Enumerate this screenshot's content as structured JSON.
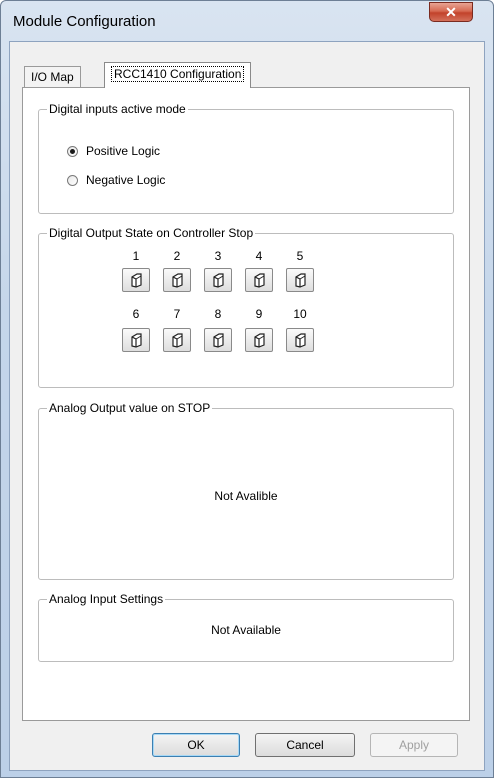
{
  "window": {
    "title": "Module Configuration",
    "close_glyph": "✕"
  },
  "tabs": [
    {
      "label": "I/O Map",
      "active": false
    },
    {
      "label": "RCC1410 Configuration",
      "active": true
    }
  ],
  "digital_inputs": {
    "legend": "Digital inputs active mode",
    "options": [
      {
        "label": "Positive Logic",
        "selected": true
      },
      {
        "label": "Negative Logic",
        "selected": false
      }
    ]
  },
  "digital_outputs": {
    "legend": "Digital Output State on Controller Stop",
    "row1": [
      "1",
      "2",
      "3",
      "4",
      "5"
    ],
    "row2": [
      "6",
      "7",
      "8",
      "9",
      "10"
    ],
    "icon": "off-state-icon"
  },
  "analog_output": {
    "legend": "Analog Output value on STOP",
    "text": "Not Avalible"
  },
  "analog_input": {
    "legend": "Analog Input Settings",
    "text": "Not Available"
  },
  "buttons": {
    "ok": "OK",
    "cancel": "Cancel",
    "apply": "Apply"
  }
}
